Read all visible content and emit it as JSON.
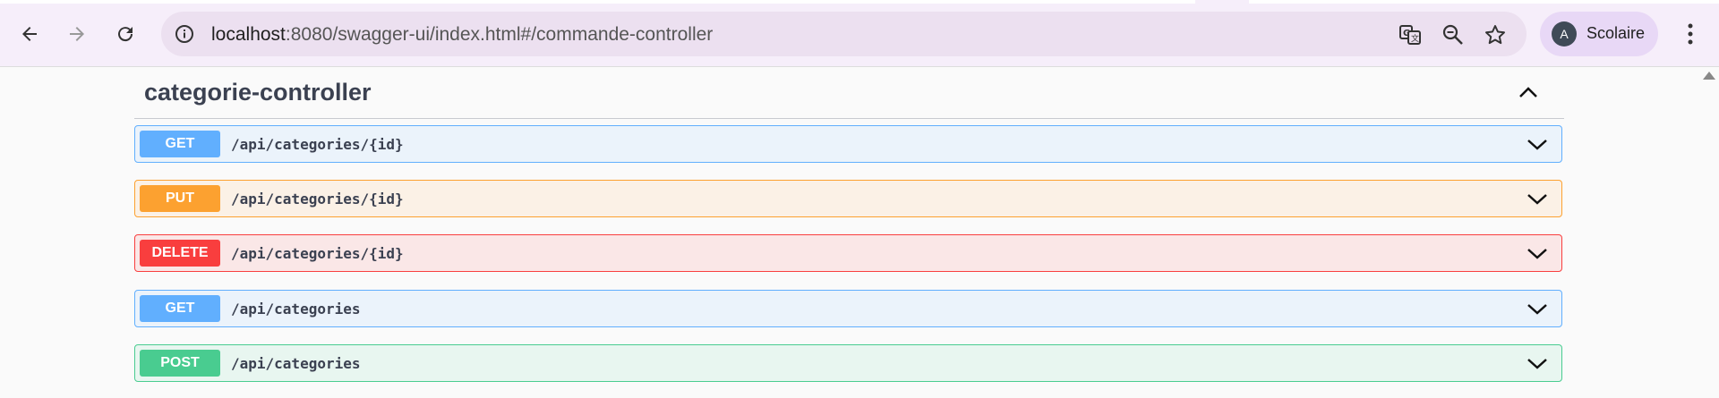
{
  "browser": {
    "url_host": "localhost",
    "url_rest": ":8080/swagger-ui/index.html#/commande-controller",
    "profile_initial": "A",
    "profile_name": "Scolaire"
  },
  "page": {
    "section_title": "categorie-controller",
    "operations": [
      {
        "method": "GET",
        "path": "/api/categories/{id}",
        "badge_color": "#61affe",
        "bg": "#ebf3fb",
        "border": "#61affe"
      },
      {
        "method": "PUT",
        "path": "/api/categories/{id}",
        "badge_color": "#fca130",
        "bg": "#fbf1e6",
        "border": "#fca130"
      },
      {
        "method": "DELETE",
        "path": "/api/categories/{id}",
        "badge_color": "#f93e3e",
        "bg": "#fae7e7",
        "border": "#f93e3e"
      },
      {
        "method": "GET",
        "path": "/api/categories",
        "badge_color": "#61affe",
        "bg": "#ebf3fb",
        "border": "#61affe"
      },
      {
        "method": "POST",
        "path": "/api/categories",
        "badge_color": "#49cc90",
        "bg": "#e8f6f0",
        "border": "#49cc90"
      }
    ]
  }
}
